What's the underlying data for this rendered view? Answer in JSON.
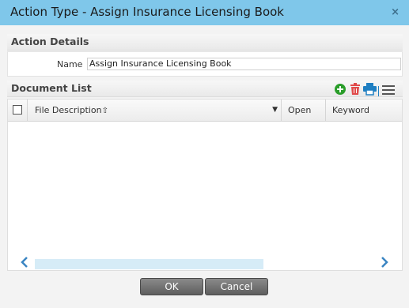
{
  "window": {
    "title": "Action Type - Assign Insurance Licensing Book",
    "close_glyph": "×"
  },
  "action_details": {
    "heading": "Action Details",
    "name_label": "Name",
    "name_value": "Assign Insurance Licensing Book"
  },
  "document_list": {
    "heading": "Document List",
    "toolbar": {
      "add_icon": "add-circle-icon",
      "delete_icon": "trash-icon",
      "print_icon": "printer-icon",
      "menu_icon": "list-menu-icon",
      "add_color": "#2a9d2a",
      "delete_color": "#e04b4b",
      "print_color": "#1f7fc2"
    },
    "columns": {
      "file_description": "File Description",
      "sort_glyph": "⇧",
      "filter_glyph": "▼",
      "open": "Open",
      "keyword": "Keyword"
    },
    "rows": [],
    "scroll_left_glyph": "‹",
    "scroll_right_glyph": "›"
  },
  "buttons": {
    "ok": "OK",
    "cancel": "Cancel"
  },
  "colors": {
    "titlebar": "#7fc7ea",
    "accent": "#3a85c2"
  }
}
